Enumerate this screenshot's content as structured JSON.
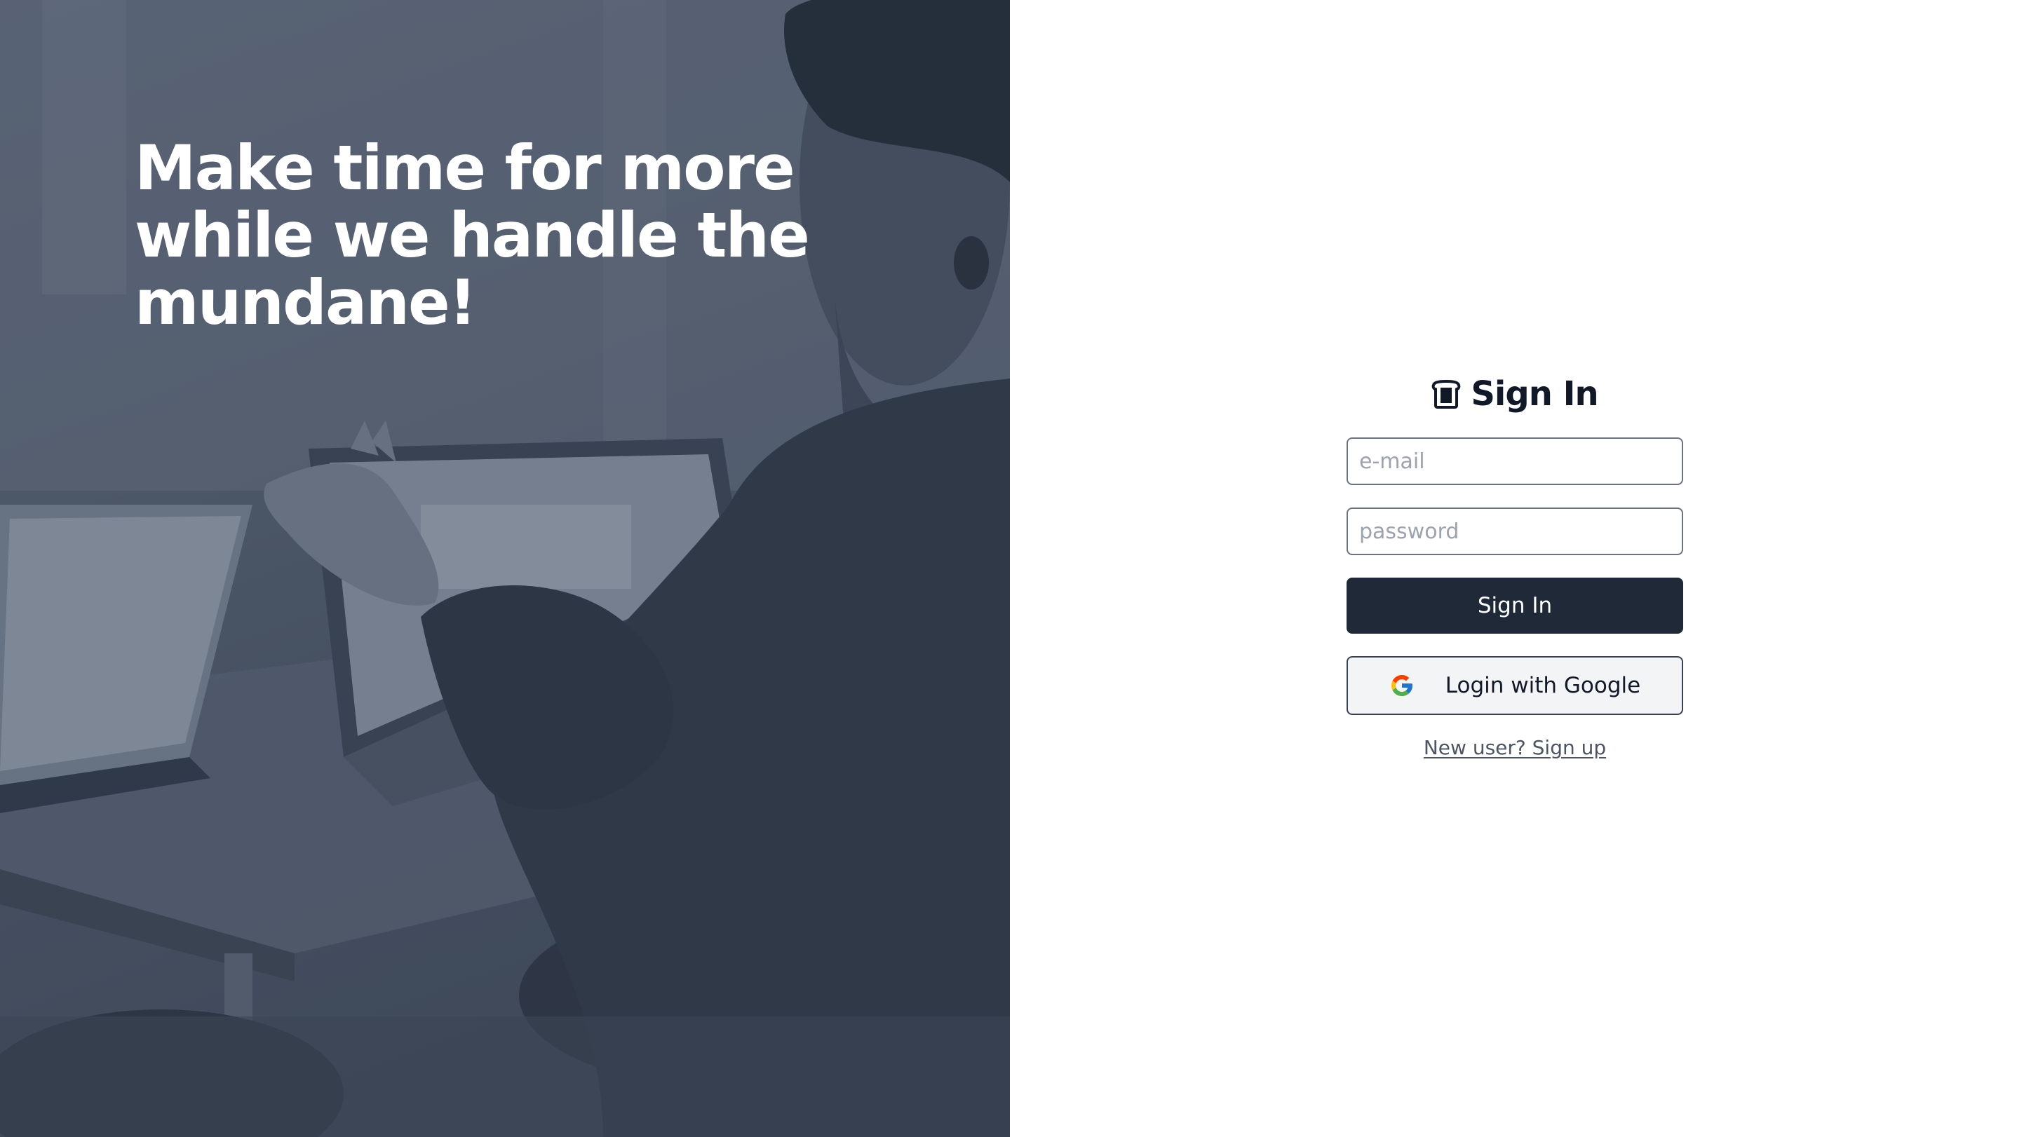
{
  "hero": {
    "headline": "Make time for more while we handle the mundane!",
    "image_description_icon": "office-photo"
  },
  "form": {
    "title": "Sign In",
    "title_icon": "bread-icon",
    "email_placeholder": "e-mail",
    "email_value": "",
    "password_placeholder": "password",
    "password_value": "",
    "sign_in_label": "Sign In",
    "google_label": "Login with Google",
    "google_icon": "google-icon",
    "signup_label": "New user? Sign up"
  },
  "colors": {
    "primary_button": "#1f2937",
    "google_button_bg": "#f3f4f6",
    "hero_tint": "#4b5563",
    "link": "#4b5563"
  }
}
